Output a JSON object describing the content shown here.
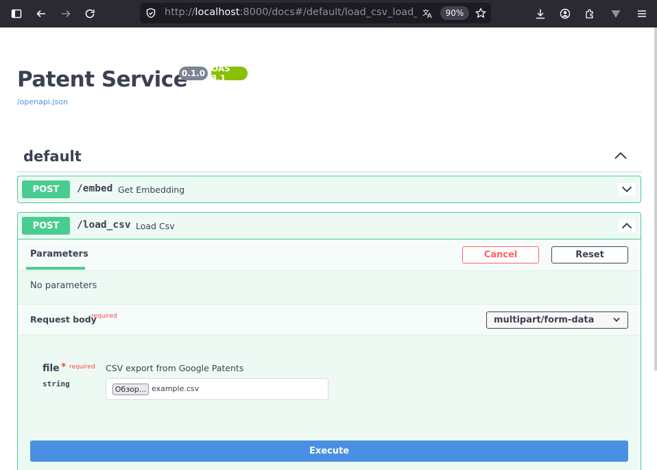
{
  "browser": {
    "url_prefix": "http://",
    "url_host": "localhost",
    "url_rest": ":8000/docs#/default/load_csv_load_c",
    "zoom": "90%"
  },
  "page": {
    "title": "Patent Service",
    "version_badge": "0.1.0",
    "oas_badge": "OAS 3.1",
    "openapi_link": "/openapi.json"
  },
  "section": {
    "title": "default"
  },
  "operations": [
    {
      "method": "POST",
      "path": "/embed",
      "summary": "Get Embedding"
    },
    {
      "method": "POST",
      "path": "/load_csv",
      "summary": "Load Csv"
    }
  ],
  "load_csv": {
    "tab_parameters": "Parameters",
    "cancel_label": "Cancel",
    "reset_label": "Reset",
    "no_parameters": "No parameters",
    "request_body_label": "Request body",
    "required_label": "required",
    "content_type": "multipart/form-data",
    "field": {
      "name": "file",
      "star": "*",
      "required": "required",
      "type": "string",
      "description": "CSV export from Google Patents",
      "browse_label": "Обзор...",
      "chosen_file": "example.csv"
    },
    "execute_label": "Execute"
  },
  "colors": {
    "post": "#49cc90",
    "execute": "#4990e2",
    "cancel": "#ff6060",
    "oas_badge": "#89bf04",
    "version_badge": "#7d8492"
  }
}
